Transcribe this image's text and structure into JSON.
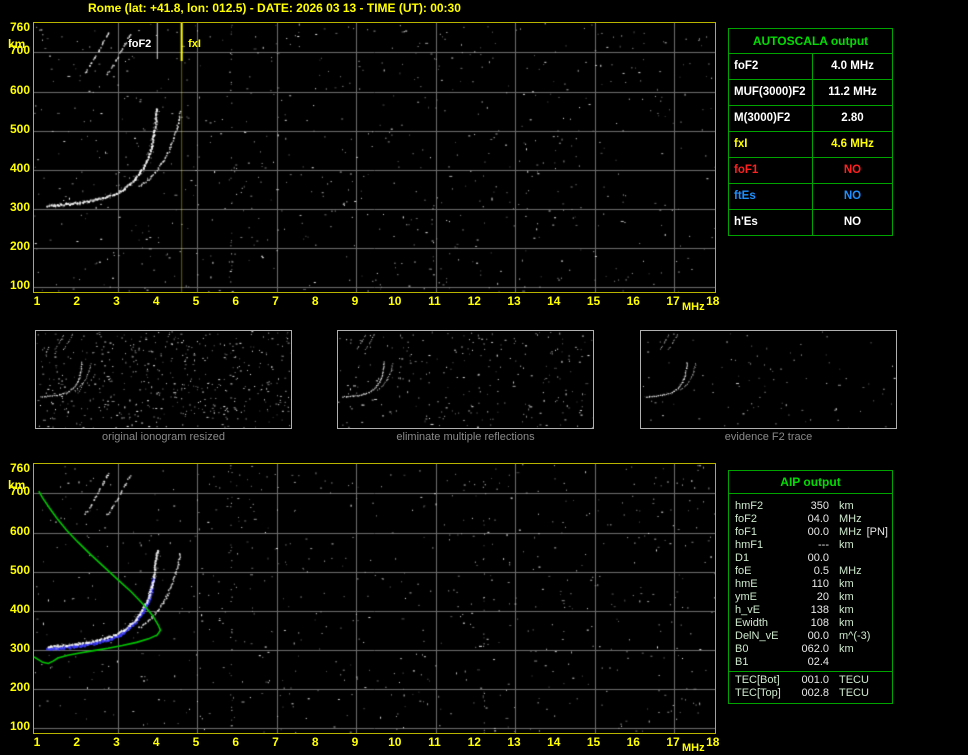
{
  "title": "Rome (lat: +41.8, lon: 012.5) - DATE: 2026 03 13 - TIME (UT): 00:30",
  "colors": {
    "background": "#000000",
    "axis_yellow": "#ffff00",
    "plot_border": "#b8b400",
    "grid_gray": "#6e6e6e",
    "table_green": "#00a400",
    "table_title_green": "#00dd00",
    "trace_white": "#ffffff",
    "profile_green": "#00c800",
    "restored_blue": "#4444ff",
    "caption_gray": "#8a8a8a"
  },
  "autoscala_table": {
    "title": "AUTOSCALA output",
    "rows": [
      {
        "label": "foF2",
        "value": "4.0 MHz",
        "color": "#ffffff"
      },
      {
        "label": "MUF(3000)F2",
        "value": "11.2 MHz",
        "color": "#ffffff"
      },
      {
        "label": "M(3000)F2",
        "value": "2.80",
        "color": "#ffffff"
      },
      {
        "label": "fxI",
        "value": "4.6 MHz",
        "color": "#ffff00"
      },
      {
        "label": "foF1",
        "value": "NO",
        "color": "#ff2020"
      },
      {
        "label": "ftEs",
        "value": "NO",
        "color": "#1e90ff"
      },
      {
        "label": "h'Es",
        "value": "NO",
        "color": "#ffffff"
      }
    ]
  },
  "aip_table": {
    "title": "AIP output",
    "rows": [
      {
        "label": "hmF2",
        "value": "350",
        "unit": "km",
        "note": "",
        "section": "main"
      },
      {
        "label": "foF2",
        "value": "04.0",
        "unit": "MHz",
        "note": "",
        "section": "main"
      },
      {
        "label": "foF1",
        "value": "00.0",
        "unit": "MHz",
        "note": "[PN]",
        "section": "main"
      },
      {
        "label": "hmF1",
        "value": "---",
        "unit": "km",
        "note": "",
        "section": "main"
      },
      {
        "label": "D1",
        "value": "00.0",
        "unit": "",
        "note": "",
        "section": "main"
      },
      {
        "label": "foE",
        "value": "0.5",
        "unit": "MHz",
        "note": "",
        "section": "main"
      },
      {
        "label": "hmE",
        "value": "110",
        "unit": "km",
        "note": "",
        "section": "main"
      },
      {
        "label": "ymE",
        "value": "20",
        "unit": "km",
        "note": "",
        "section": "main"
      },
      {
        "label": "h_vE",
        "value": "138",
        "unit": "km",
        "note": "",
        "section": "main"
      },
      {
        "label": "Ewidth",
        "value": "108",
        "unit": "km",
        "note": "",
        "section": "main"
      },
      {
        "label": "DelN_vE",
        "value": "00.0",
        "unit": "m^(-3)",
        "note": "",
        "section": "main"
      },
      {
        "label": "B0",
        "value": "062.0",
        "unit": "km",
        "note": "",
        "section": "main"
      },
      {
        "label": "B1",
        "value": "02.4",
        "unit": "",
        "note": "",
        "section": "main"
      },
      {
        "label": "TEC[Bot]",
        "value": "001.0",
        "unit": "TECU",
        "note": "",
        "section": "tec"
      },
      {
        "label": "TEC[Top]",
        "value": "002.8",
        "unit": "TECU",
        "note": "",
        "section": "tec"
      }
    ]
  },
  "chart_data": [
    {
      "id": "main-ionogram",
      "type": "scatter",
      "title": "scaled ionogram with AUTOSCALA markers",
      "xlabel": "MHz",
      "ylabel": "km",
      "xlim": [
        1,
        18
      ],
      "ylim": [
        100,
        760
      ],
      "x_ticks": [
        1,
        2,
        3,
        4,
        5,
        6,
        7,
        8,
        9,
        10,
        11,
        12,
        13,
        14,
        15,
        16,
        17,
        18
      ],
      "y_ticks": [
        760,
        700,
        600,
        500,
        400,
        300,
        200,
        100
      ],
      "grid": {
        "x_lines": [
          3,
          5,
          7,
          9,
          11,
          13,
          15,
          17
        ],
        "y_lines": [
          100,
          200,
          300,
          400,
          500,
          600,
          700
        ]
      },
      "markers": {
        "foF2": {
          "label": "foF2",
          "MHz": 4.0
        },
        "fxI": {
          "label": "fxI",
          "MHz": 4.6
        }
      },
      "traces": {
        "o_trace": [
          [
            1.25,
            307
          ],
          [
            1.5,
            309
          ],
          [
            1.75,
            311
          ],
          [
            2.0,
            314
          ],
          [
            2.25,
            318
          ],
          [
            2.5,
            323
          ],
          [
            2.75,
            330
          ],
          [
            3.0,
            339
          ],
          [
            3.15,
            349
          ],
          [
            3.3,
            361
          ],
          [
            3.45,
            375
          ],
          [
            3.58,
            392
          ],
          [
            3.7,
            412
          ],
          [
            3.79,
            434
          ],
          [
            3.86,
            458
          ],
          [
            3.92,
            486
          ],
          [
            3.96,
            514
          ],
          [
            3.99,
            542
          ],
          [
            4.0,
            555
          ]
        ],
        "x_trace": [
          [
            3.55,
            356
          ],
          [
            3.72,
            369
          ],
          [
            3.88,
            384
          ],
          [
            4.02,
            401
          ],
          [
            4.15,
            420
          ],
          [
            4.27,
            442
          ],
          [
            4.37,
            466
          ],
          [
            4.46,
            492
          ],
          [
            4.53,
            520
          ],
          [
            4.58,
            548
          ]
        ],
        "second_hop_o": [
          [
            2.2,
            648
          ],
          [
            2.35,
            672
          ],
          [
            2.5,
            698
          ],
          [
            2.65,
            726
          ],
          [
            2.78,
            752
          ]
        ],
        "second_hop_x": [
          [
            2.75,
            645
          ],
          [
            2.9,
            668
          ],
          [
            3.05,
            694
          ],
          [
            3.2,
            722
          ],
          [
            3.35,
            750
          ]
        ]
      },
      "noise": {
        "seed": 7,
        "count": 750
      },
      "interference_MHz": [
        5.85
      ]
    },
    {
      "id": "thumb-original",
      "type": "scatter",
      "caption": "original ionogram resized",
      "traces_ref": 0,
      "noise": {
        "seed": 21,
        "count": 520
      }
    },
    {
      "id": "thumb-filtered",
      "type": "scatter",
      "caption": "eliminate multiple reflections",
      "traces_ref": 0,
      "noise": {
        "seed": 33,
        "count": 260
      }
    },
    {
      "id": "thumb-f2",
      "type": "scatter",
      "caption": "evidence F2 trace",
      "traces_ref": 0,
      "noise": {
        "seed": 45,
        "count": 90
      }
    },
    {
      "id": "restored-ionogram",
      "type": "scatter",
      "title": "ionogram with restored trace and electron density profile",
      "xlabel": "MHz",
      "ylabel": "km",
      "xlim": [
        1,
        18
      ],
      "ylim": [
        100,
        760
      ],
      "x_ticks": [
        1,
        2,
        3,
        4,
        5,
        6,
        7,
        8,
        9,
        10,
        11,
        12,
        13,
        14,
        15,
        16,
        17,
        18
      ],
      "y_ticks": [
        760,
        700,
        600,
        500,
        400,
        300,
        200,
        100
      ],
      "grid": {
        "x_lines": [
          3,
          5,
          7,
          9,
          11,
          13,
          15,
          17
        ],
        "y_lines": [
          100,
          200,
          300,
          400,
          500,
          600,
          700
        ]
      },
      "traces_ref": 0,
      "restored_blue": {
        "max_h": 500
      },
      "profile_green": [
        [
          1.02,
          706
        ],
        [
          1.12,
          688
        ],
        [
          1.28,
          664
        ],
        [
          1.48,
          636
        ],
        [
          1.72,
          606
        ],
        [
          2.0,
          576
        ],
        [
          2.32,
          544
        ],
        [
          2.66,
          512
        ],
        [
          3.0,
          480
        ],
        [
          3.35,
          448
        ],
        [
          3.65,
          416
        ],
        [
          3.88,
          388
        ],
        [
          4.02,
          364
        ],
        [
          4.08,
          350
        ],
        [
          4.0,
          338
        ],
        [
          3.78,
          328
        ],
        [
          3.48,
          319
        ],
        [
          3.12,
          311
        ],
        [
          2.76,
          304
        ],
        [
          2.4,
          298
        ],
        [
          2.05,
          292
        ],
        [
          1.75,
          286
        ],
        [
          1.5,
          279
        ],
        [
          1.38,
          271
        ],
        [
          1.26,
          265
        ],
        [
          1.12,
          268
        ],
        [
          0.98,
          277
        ],
        [
          0.9,
          282
        ]
      ],
      "noise": {
        "seed": 55,
        "count": 700
      },
      "interference_MHz": [
        5.85,
        12.2
      ]
    }
  ]
}
